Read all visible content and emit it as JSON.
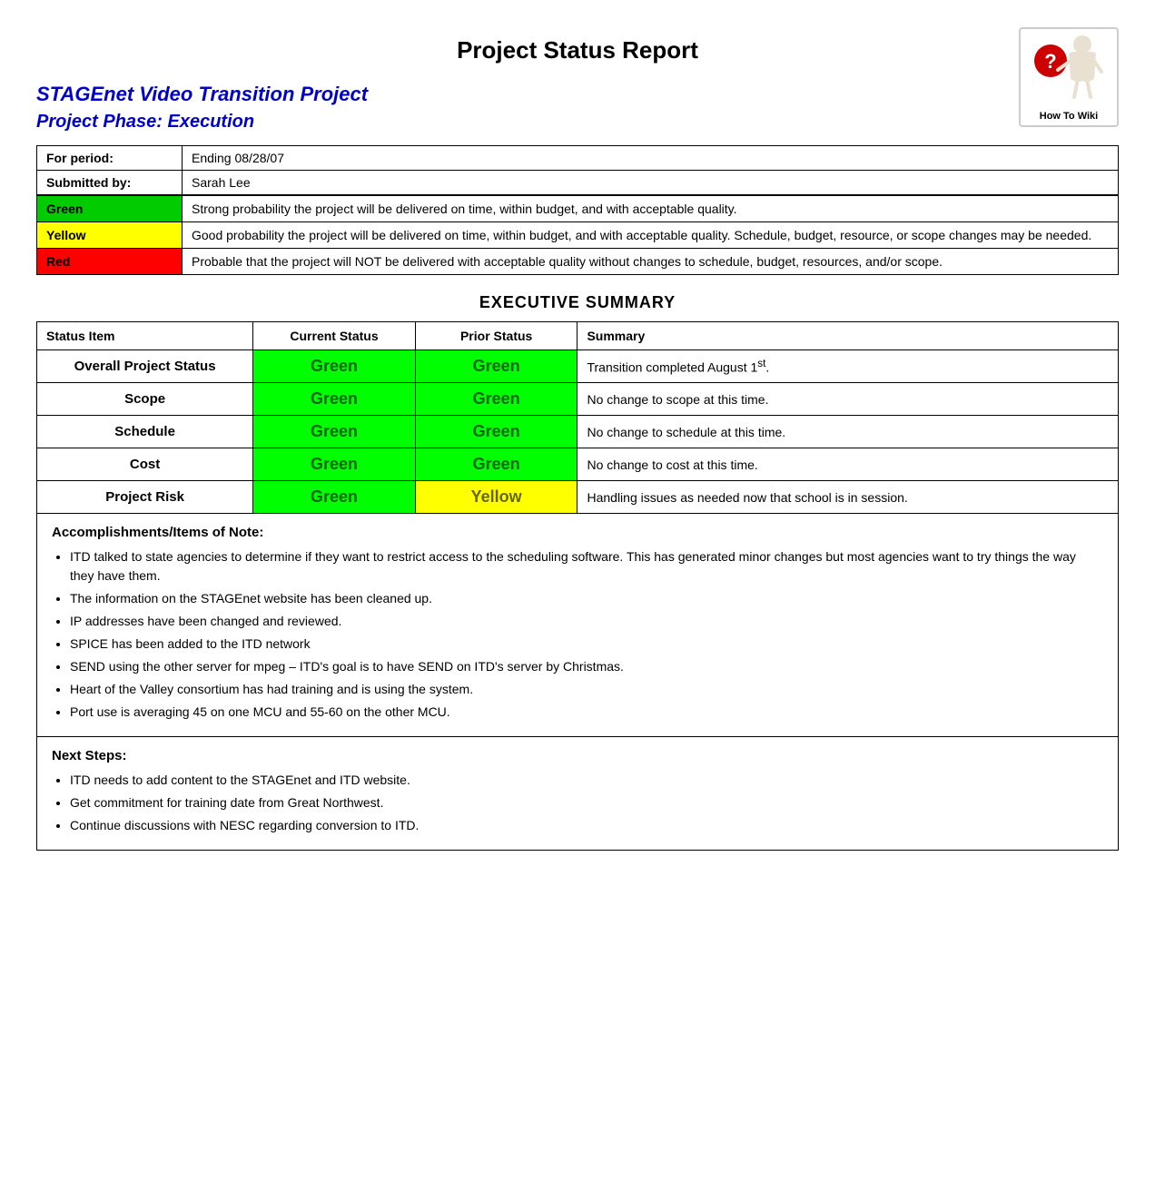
{
  "header": {
    "title": "Project Status Report",
    "how_to_label": "How To Wiki"
  },
  "project": {
    "title": "STAGEnet Video Transition Project",
    "phase": "Project Phase: Execution"
  },
  "info": {
    "period_label": "For period:",
    "period_value": "Ending 08/28/07",
    "submitted_label": "Submitted by:",
    "submitted_value": "Sarah Lee"
  },
  "legend": {
    "green_label": "Green",
    "green_desc": "Strong probability the project will be delivered on time, within budget, and with acceptable quality.",
    "yellow_label": "Yellow",
    "yellow_desc": "Good probability the project will be delivered on time, within budget, and with acceptable quality. Schedule, budget, resource, or scope changes may be needed.",
    "red_label": "Red",
    "red_desc": "Probable that the project will NOT be delivered with acceptable quality without changes to schedule, budget, resources, and/or scope."
  },
  "executive_summary": {
    "title": "EXECUTIVE SUMMARY",
    "columns": {
      "status_item": "Status Item",
      "current_status": "Current Status",
      "prior_status": "Prior Status",
      "summary": "Summary"
    },
    "rows": [
      {
        "item": "Overall Project Status",
        "current": "Green",
        "prior": "Green",
        "summary": "Transition completed August 1st.",
        "current_color": "green",
        "prior_color": "green"
      },
      {
        "item": "Scope",
        "current": "Green",
        "prior": "Green",
        "summary": "No change to scope at this time.",
        "current_color": "green",
        "prior_color": "green"
      },
      {
        "item": "Schedule",
        "current": "Green",
        "prior": "Green",
        "summary": "No change to schedule at this time.",
        "current_color": "green",
        "prior_color": "green"
      },
      {
        "item": "Cost",
        "current": "Green",
        "prior": "Green",
        "summary": "No change to cost at this time.",
        "current_color": "green",
        "prior_color": "green"
      },
      {
        "item": "Project Risk",
        "current": "Green",
        "prior": "Yellow",
        "summary": "Handling issues as needed now that school is in session.",
        "current_color": "green",
        "prior_color": "yellow"
      }
    ]
  },
  "accomplishments": {
    "title": "Accomplishments/Items of Note:",
    "items": [
      "ITD talked to state agencies to determine if they want to restrict access to the scheduling software.  This has generated minor changes but most agencies want to try things the way they have them.",
      "The information on the STAGEnet website has been cleaned up.",
      "IP addresses have been changed and reviewed.",
      "SPICE has been added to the ITD network",
      "SEND using the other server for mpeg – ITD's goal is to have SEND on ITD's server by Christmas.",
      "Heart of the Valley consortium has had training and is using the system.",
      "Port use is averaging 45 on one MCU and 55-60 on the other MCU."
    ]
  },
  "next_steps": {
    "title": "Next Steps:",
    "items": [
      "ITD needs to add content to the STAGEnet and ITD website.",
      "Get commitment for training date from Great Northwest.",
      "Continue discussions with NESC regarding conversion to ITD."
    ]
  }
}
